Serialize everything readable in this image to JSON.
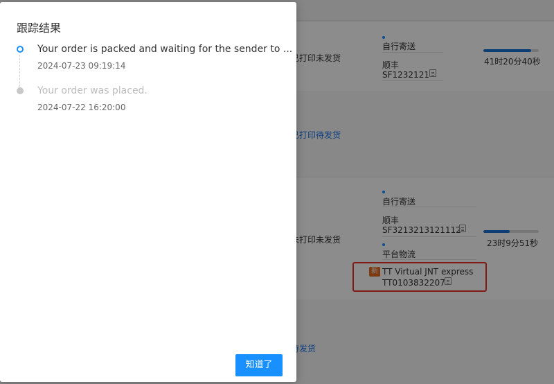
{
  "modal": {
    "title": "跟踪结果",
    "events": [
      {
        "text": "Your order is packed and waiting for the sender to ...",
        "time": "2024-07-23 09:19:14",
        "state": "active"
      },
      {
        "text": "Your order was placed.",
        "time": "2024-07-22 16:20:00",
        "state": "past"
      }
    ],
    "ok_label": "知道了"
  },
  "orders": [
    {
      "status": "已打印未发货",
      "shipping_type": "自行寄送",
      "carrier": "顺丰",
      "tracking": "SF1232121",
      "countdown": "41时20分40秒",
      "progress": 0.86,
      "sub_status": "已打印待发货"
    },
    {
      "status": "未打印未发货",
      "shipping_type": "自行寄送",
      "carrier": "顺丰",
      "tracking": "SF3213213121112",
      "platform_label": "平台物流",
      "new_badge": "新",
      "platform_carrier": "TT Virtual JNT express",
      "platform_tracking": "TT0103832207",
      "countdown": "23时9分51秒",
      "progress": 0.48,
      "sub_status": "待发货"
    }
  ],
  "colors": {
    "accent": "#1890ff",
    "progress": "#1b6fd1",
    "badge": "#e26a1a",
    "highlight": "#e8302a"
  }
}
